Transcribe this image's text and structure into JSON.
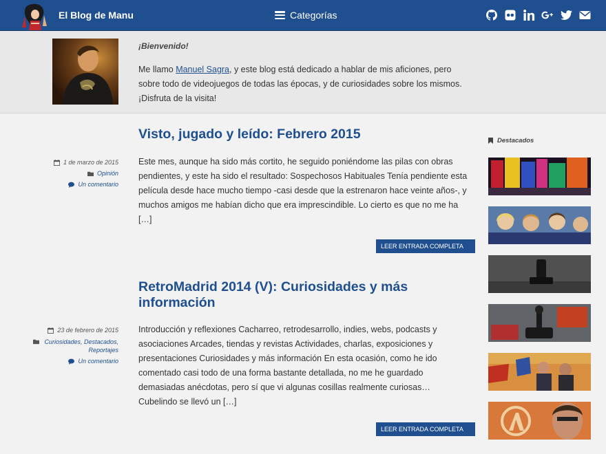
{
  "header": {
    "site_title": "El Blog de Manu",
    "categories_label": "Categorías",
    "social_icons": [
      "github-icon",
      "flickr-icon",
      "linkedin-icon",
      "google-plus-icon",
      "twitter-icon",
      "email-icon"
    ]
  },
  "welcome": {
    "heading": "¡Bienvenido!",
    "text_before": "Me llamo ",
    "author_link": "Manuel Sagra",
    "text_after": ", y este blog está dedicado a hablar de mis aficiones, pero sobre todo de videojuegos de todas las épocas, y de curiosidades sobre los mismos. ¡Disfruta de la visita!"
  },
  "posts": [
    {
      "title": "Visto, jugado y leído: Febrero 2015",
      "date": "1 de marzo de 2015",
      "categories": "Opinión",
      "comments": "Un comentario",
      "excerpt": "Este mes, aunque ha sido más cortito, he seguido poniéndome las pilas con obras pendientes, y este ha sido el resultado: Sospechosos Habituales Tenía pendiente esta película desde hace mucho tiempo -casi desde que la estrenaron hace veinte años-, y muchos amigos me habían dicho que era imprescindible. Lo cierto es que no me ha […]",
      "read_more": "LEER ENTRADA COMPLETA"
    },
    {
      "title": "RetroMadrid 2014 (V): Curiosidades y más información",
      "date": "23 de febrero de 2015",
      "categories": "Curiosidades, Destacados, Reportajes",
      "comments": "Un comentario",
      "excerpt": "Introducción y reflexiones Cacharreo, retrodesarrollo, indies, webs, podcasts y asociaciones Arcades, tiendas y revistas Actividades, charlas, exposiciones y presentaciones Curiosidades y más información En esta ocasión, como he ido comentado casi todo de una forma bastante detallada, no me he guardado demasiadas anécdotas, pero sí que vi algunas cosillas realmente curiosas… Cubelindo se llevó un […]",
      "read_more": "LEER ENTRADA COMPLETA"
    }
  ],
  "sidebar": {
    "heading": "Destacados"
  },
  "colors": {
    "brand": "#1f4f8f",
    "background": "#f2f2f2",
    "welcome_bg": "#e8e8e8"
  }
}
